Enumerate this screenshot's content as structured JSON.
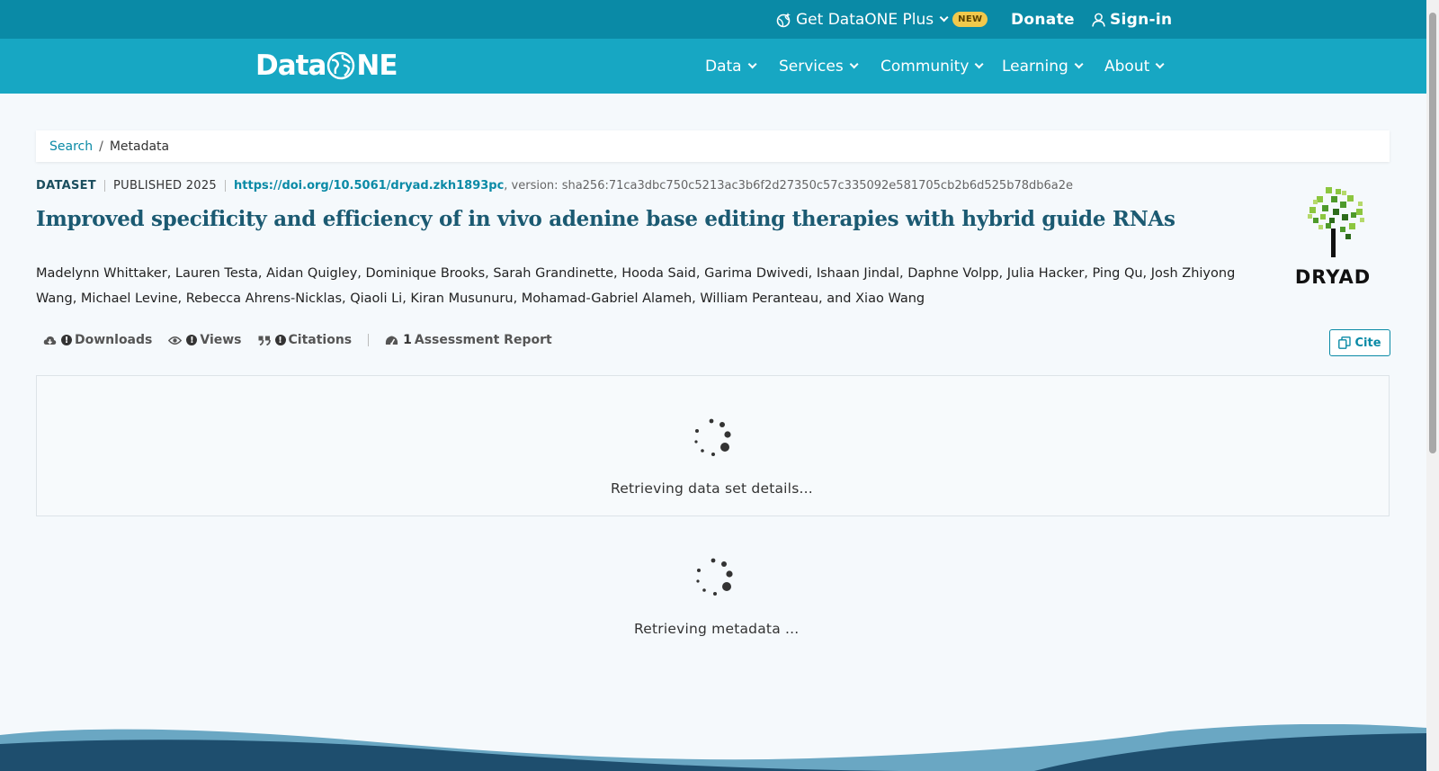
{
  "topbar": {
    "plus_label": "Get DataONE Plus",
    "new_badge": "NEW",
    "donate_label": "Donate",
    "signin_label": "Sign-in"
  },
  "nav": {
    "logo_text_left": "Data",
    "logo_text_right": "NE",
    "items": [
      "Data",
      "Services",
      "Community",
      "Learning",
      "About"
    ]
  },
  "breadcrumb": {
    "search_label": "Search",
    "separator": "/",
    "current_label": "Metadata"
  },
  "dataset": {
    "type_label": "DATASET",
    "published_label": "PUBLISHED 2025",
    "doi": "https://doi.org/10.5061/dryad.zkh1893pc",
    "version": ", version: sha256:71ca3dbc750c5213ac3b6f2d27350c57c335092e581705cb2b6d525b78db6a2e",
    "title": "Improved specificity and efficiency of in vivo adenine base editing therapies with hybrid guide RNAs",
    "authors": "Madelynn Whittaker, Lauren Testa, Aidan Quigley, Dominique Brooks, Sarah Grandinette, Hooda Said, Garima Dwivedi, Ishaan Jindal, Daphne Volpp, Julia Hacker, Ping Qu, Josh Zhiyong Wang, Michael Levine, Rebecca Ahrens-Nicklas, Qiaoli Li, Kiran Musunuru, Mohamad-Gabriel Alameh, William Peranteau, and Xiao Wang",
    "repository_logo_label": "DRYAD"
  },
  "metrics": {
    "downloads_label": "Downloads",
    "views_label": "Views",
    "citations_label": "Citations",
    "assessment_count": "1",
    "assessment_label": "Assessment Report",
    "alert_glyph": "!"
  },
  "cite_label": "Cite",
  "loading": {
    "details_text": "Retrieving data set details...",
    "metadata_text": "Retrieving metadata ..."
  },
  "colors": {
    "topbar": "#0a8aa6",
    "nav": "#17a7c3",
    "title": "#1b5a72",
    "link": "#0a8aa6",
    "new_badge": "#f2c94c"
  }
}
